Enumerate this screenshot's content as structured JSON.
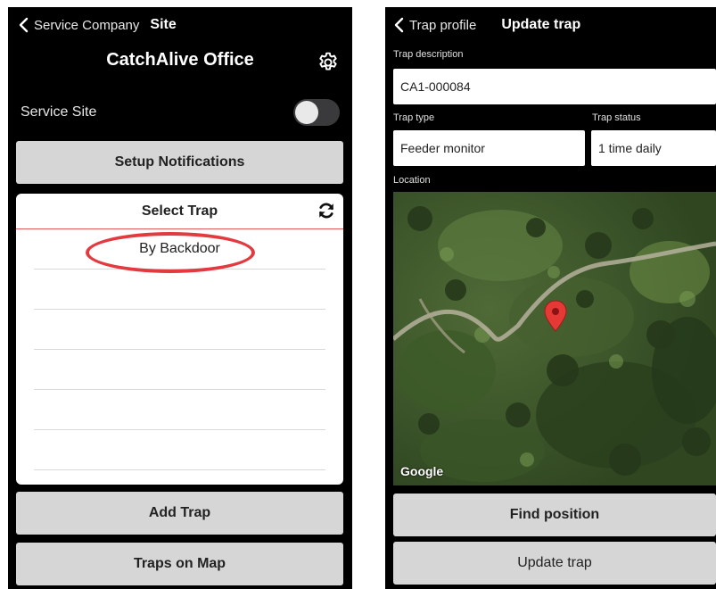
{
  "left": {
    "nav": {
      "back_label": "Service Company",
      "current": "Site"
    },
    "title": "CatchAlive Office",
    "service_site_label": "Service Site",
    "service_site_enabled": false,
    "setup_notifications_label": "Setup Notifications",
    "select_trap": {
      "title": "Select Trap",
      "items": [
        "By Backdoor",
        "",
        "",
        "",
        "",
        ""
      ]
    },
    "add_trap_label": "Add Trap",
    "traps_on_map_label": "Traps on Map"
  },
  "right": {
    "nav": {
      "back_label": "Trap profile",
      "current": "Update trap"
    },
    "trap_description_label": "Trap description",
    "trap_description_value": "CA1-000084",
    "trap_type_label": "Trap type",
    "trap_type_value": "Feeder monitor",
    "trap_status_label": "Trap status",
    "trap_status_value": "1 time daily",
    "location_label": "Location",
    "map_attribution": "Google",
    "find_position_label": "Find position",
    "update_trap_label": "Update trap"
  },
  "icons": {
    "back": "chevron-left-icon",
    "settings": "gear-icon",
    "refresh": "refresh-icon",
    "marker": "map-marker-icon"
  },
  "colors": {
    "background": "#000000",
    "button": "#d6d6d6",
    "highlight_circle": "#e23a3f",
    "list_divider": "#e35a5a",
    "marker": "#e53935"
  }
}
